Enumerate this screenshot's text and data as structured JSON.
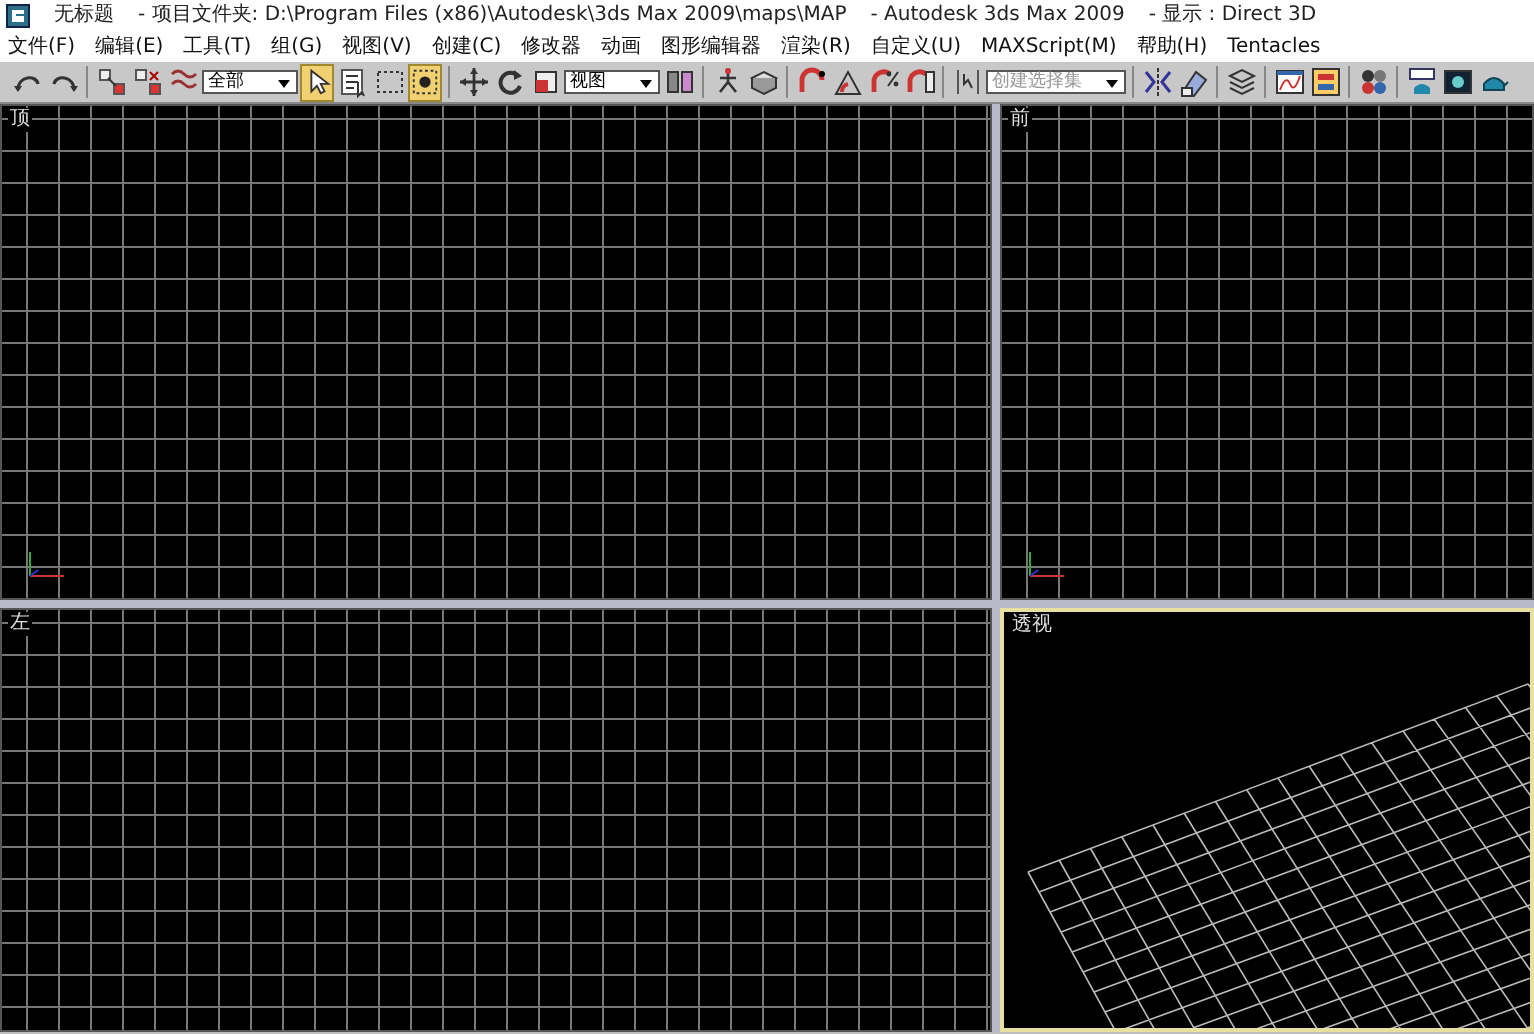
{
  "window": {
    "title": "无标题",
    "project_folder": "- 项目文件夹: D:\\Program Files (x86)\\Autodesk\\3ds Max 2009\\maps\\MAP",
    "app": "- Autodesk 3ds Max  2009",
    "display": "- 显示 : Direct 3D"
  },
  "menu": [
    "文件(F)",
    "编辑(E)",
    "工具(T)",
    "组(G)",
    "视图(V)",
    "创建(C)",
    "修改器",
    "动画",
    "图形编辑器",
    "渲染(R)",
    "自定义(U)",
    "MAXScript(M)",
    "帮助(H)",
    "Tentacles"
  ],
  "toolbar": [
    {
      "kind": "button",
      "selected": false
    },
    {
      "kind": "button",
      "selected": false
    },
    {
      "kind": "separator"
    },
    {
      "kind": "button",
      "selected": false
    },
    {
      "kind": "button",
      "selected": false
    },
    {
      "kind": "button",
      "selected": false
    },
    {
      "kind": "dropdown",
      "value": "全部"
    },
    {
      "kind": "button",
      "selected": true
    },
    {
      "kind": "button",
      "selected": false
    },
    {
      "kind": "button",
      "selected": false
    },
    {
      "kind": "button",
      "selected": true
    },
    {
      "kind": "separator"
    },
    {
      "kind": "button",
      "selected": false
    },
    {
      "kind": "button",
      "selected": false
    },
    {
      "kind": "button",
      "selected": false
    },
    {
      "kind": "dropdown",
      "value": "视图"
    },
    {
      "kind": "button",
      "selected": false
    },
    {
      "kind": "separator"
    },
    {
      "kind": "button",
      "selected": false
    },
    {
      "kind": "button",
      "selected": false
    },
    {
      "kind": "separator"
    },
    {
      "kind": "button",
      "selected": false
    },
    {
      "kind": "button",
      "selected": false
    },
    {
      "kind": "button",
      "selected": false
    },
    {
      "kind": "button",
      "selected": false
    },
    {
      "kind": "separator"
    },
    {
      "kind": "button",
      "selected": false
    },
    {
      "kind": "dropdown",
      "placeholder": "创建选择集"
    },
    {
      "kind": "separator"
    },
    {
      "kind": "button",
      "selected": false
    },
    {
      "kind": "button",
      "selected": false
    },
    {
      "kind": "separator"
    },
    {
      "kind": "button",
      "selected": false
    },
    {
      "kind": "separator"
    },
    {
      "kind": "button",
      "selected": false
    },
    {
      "kind": "button",
      "selected": false
    },
    {
      "kind": "separator"
    },
    {
      "kind": "button",
      "selected": false
    },
    {
      "kind": "separator"
    },
    {
      "kind": "button",
      "selected": false
    },
    {
      "kind": "button",
      "selected": false
    },
    {
      "kind": "button",
      "selected": false
    }
  ],
  "viewports": [
    {
      "label": "顶",
      "kind": "ortho",
      "active": false
    },
    {
      "label": "前",
      "kind": "ortho",
      "active": false
    },
    {
      "label": "左",
      "kind": "ortho",
      "active": false
    },
    {
      "label": "透视",
      "kind": "perspective",
      "active": true
    }
  ]
}
